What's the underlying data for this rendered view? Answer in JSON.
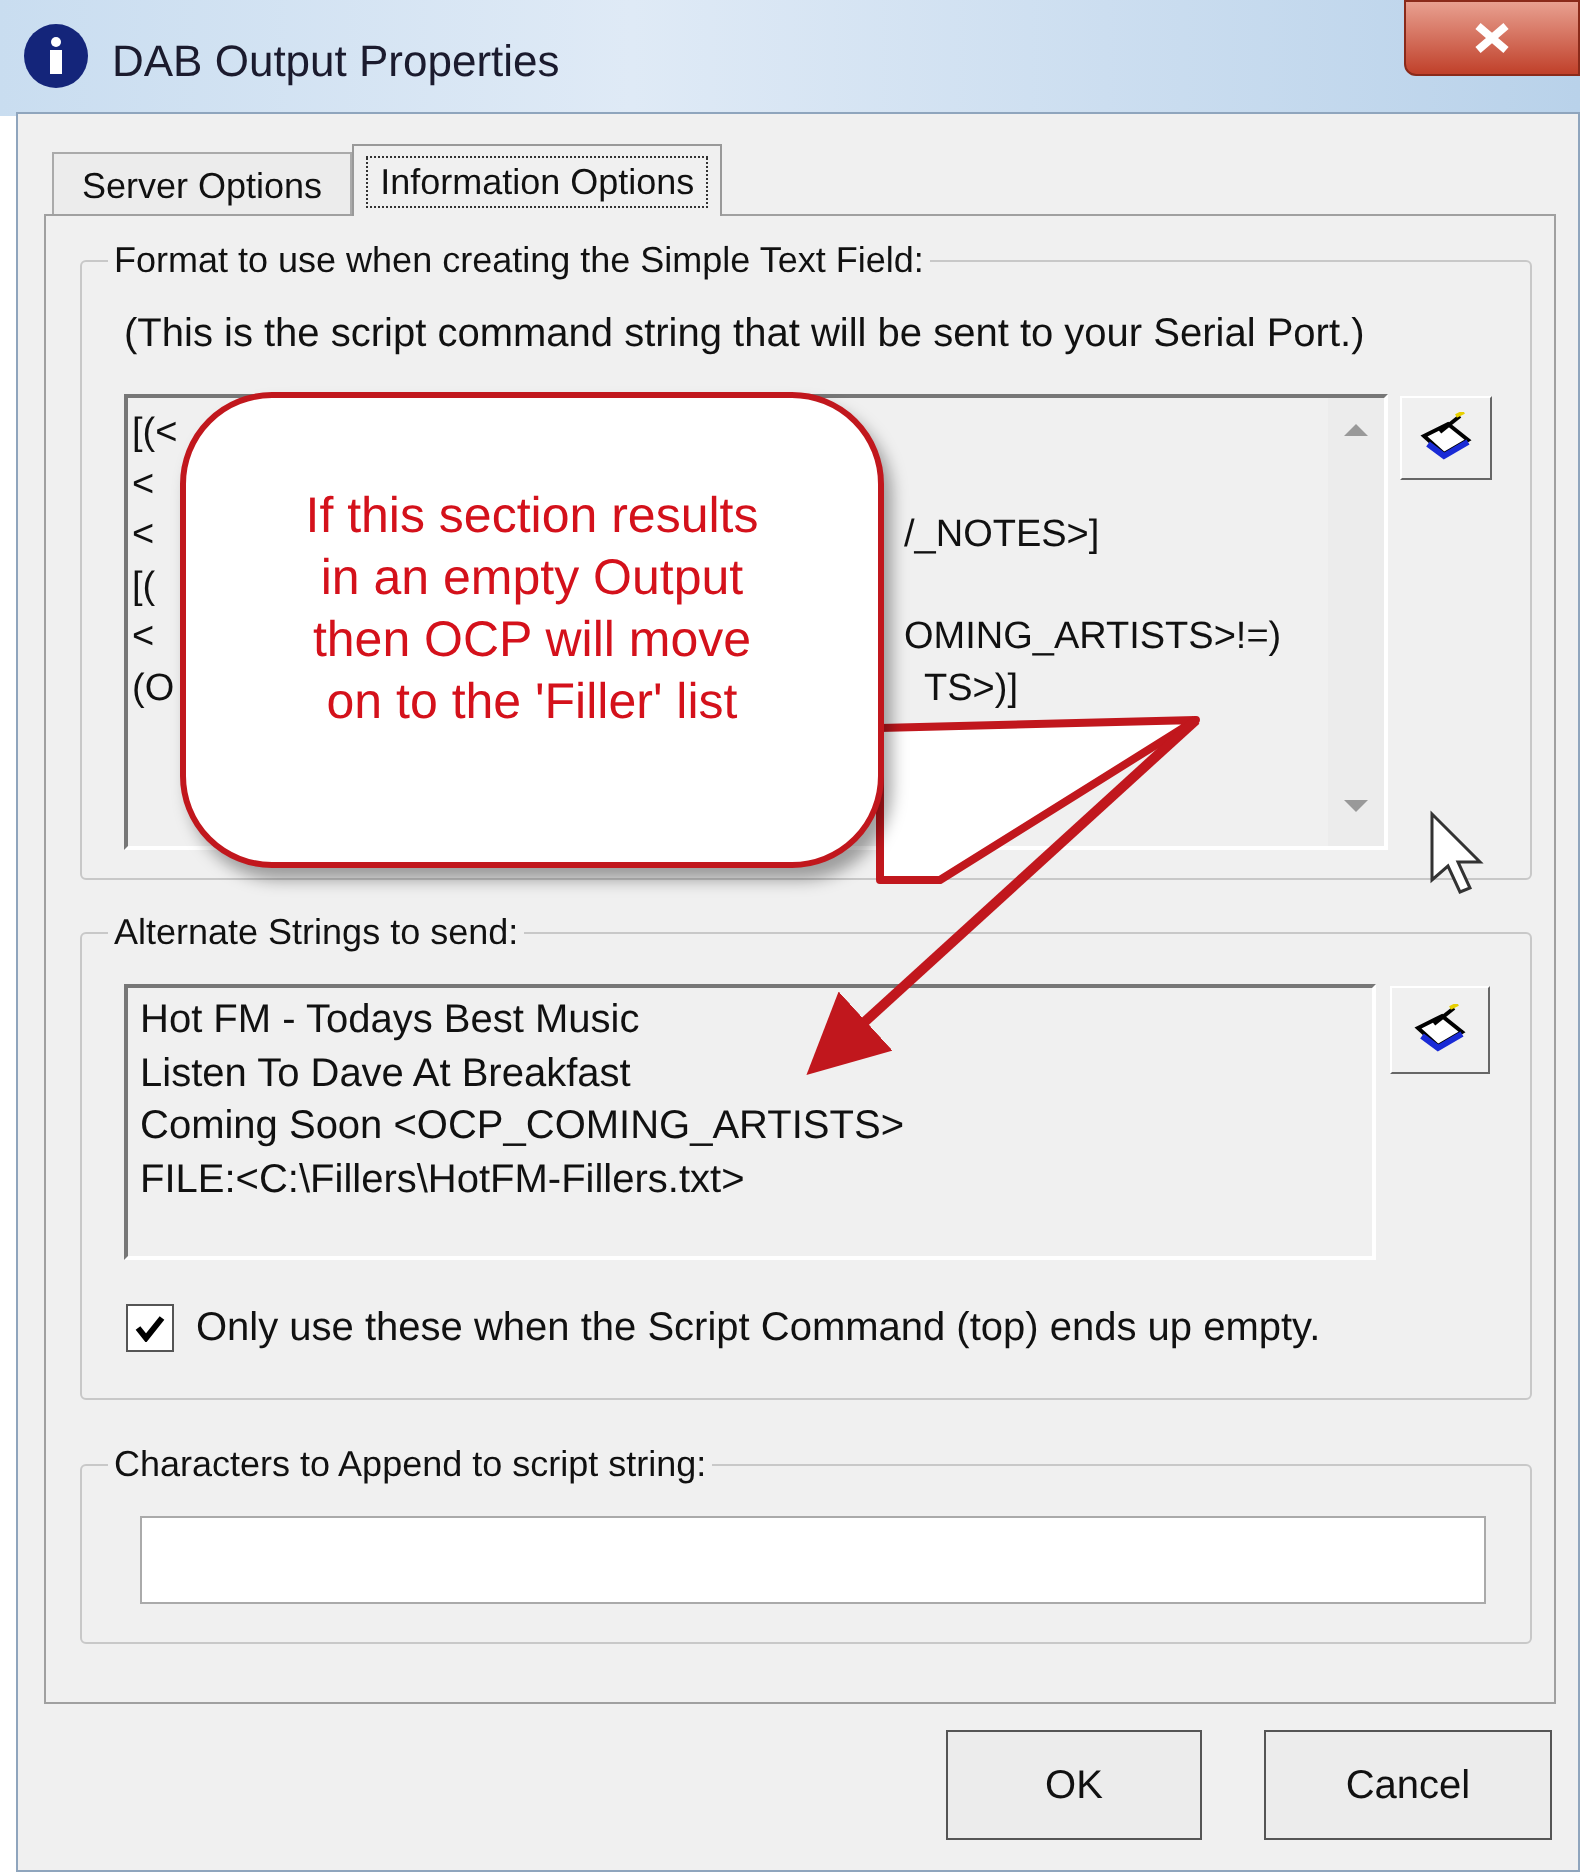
{
  "window": {
    "title": "DAB Output Properties"
  },
  "tabs": [
    {
      "label": "Server Options",
      "selected": false
    },
    {
      "label": "Information Options",
      "selected": true
    }
  ],
  "script_group": {
    "label": "Format to use when creating the Simple Text Field:",
    "hint": "(This is the script command string that will be sent to your Serial Port.)",
    "lines": [
      {
        "start": "[(<"
      },
      {
        "start": "<"
      },
      {
        "start": "<",
        "end": "/_NOTES>]"
      },
      {
        "start": "[("
      },
      {
        "start": "<",
        "end": "OMING_ARTISTS>!=)"
      },
      {
        "start": "(O",
        "end": "TS>)]"
      }
    ]
  },
  "alternate_group": {
    "label": "Alternate Strings to send:",
    "lines": [
      "Hot FM - Todays Best Music",
      "Listen To Dave At Breakfast",
      "Coming Soon <OCP_COMING_ARTISTS>",
      "FILE:<C:\\Fillers\\HotFM-Fillers.txt>"
    ],
    "checkbox": {
      "label": "Only use these when the Script Command (top) ends up empty.",
      "checked": true
    }
  },
  "append_group": {
    "label": "Characters to Append to script string:"
  },
  "callout": {
    "lines": [
      "If this section results",
      "in an empty Output",
      "then OCP will move",
      "on to the 'Filler' list"
    ]
  },
  "buttons": [
    {
      "label": "OK"
    },
    {
      "label": "Cancel"
    }
  ]
}
